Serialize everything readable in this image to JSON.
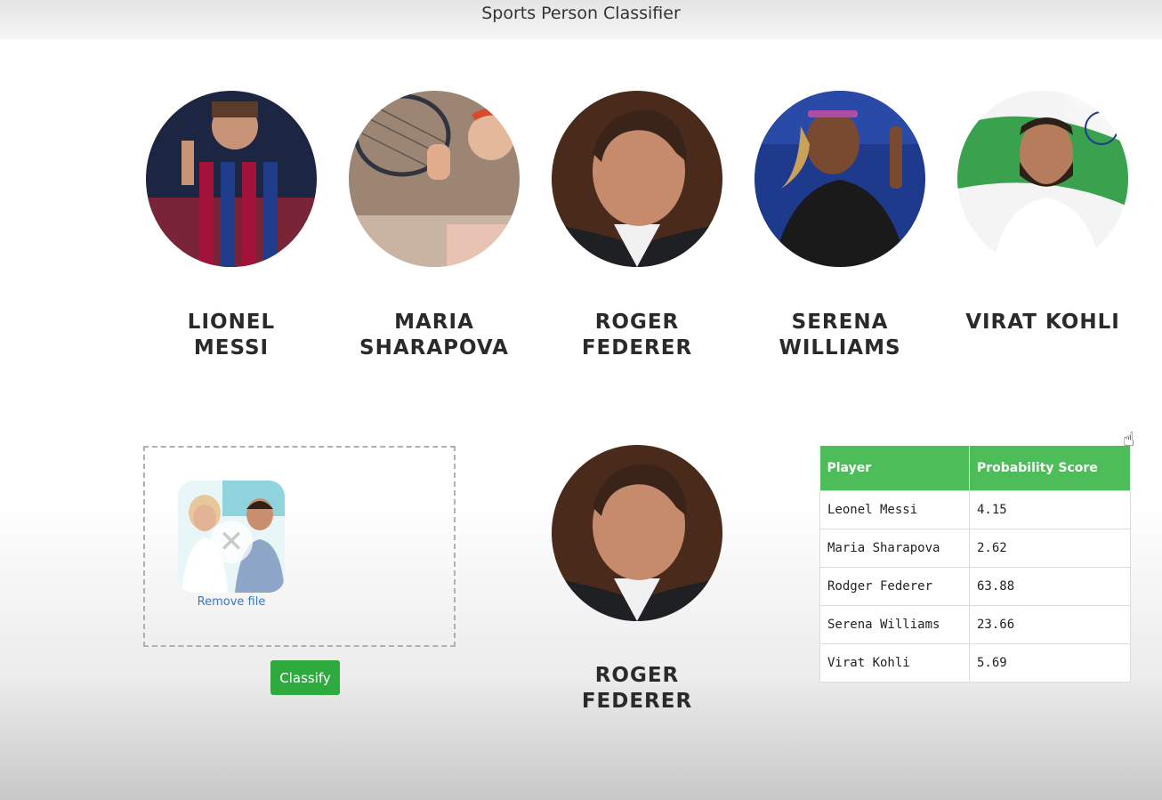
{
  "header": {
    "title": "Sports Person Classifier"
  },
  "players": [
    {
      "id": "messi",
      "name_line1": "LIONEL",
      "name_line2": "MESSI"
    },
    {
      "id": "sharapova",
      "name_line1": "MARIA",
      "name_line2": "SHARAPOVA"
    },
    {
      "id": "federer",
      "name_line1": "ROGER",
      "name_line2": "FEDERER"
    },
    {
      "id": "williams",
      "name_line1": "SERENA",
      "name_line2": "WILLIAMS"
    },
    {
      "id": "kohli",
      "name_line1": "VIRAT KOHLI",
      "name_line2": ""
    }
  ],
  "upload": {
    "remove_label": "Remove file",
    "classify_label": "Classify"
  },
  "result": {
    "name": "ROGER FEDERER"
  },
  "table": {
    "headers": [
      "Player",
      "Probability Score"
    ],
    "rows": [
      {
        "player": "Leonel Messi",
        "score": "4.15"
      },
      {
        "player": "Maria Sharapova",
        "score": "2.62"
      },
      {
        "player": "Rodger Federer",
        "score": "63.88"
      },
      {
        "player": "Serena Williams",
        "score": "23.66"
      },
      {
        "player": "Virat Kohli",
        "score": "5.69"
      }
    ]
  },
  "colors": {
    "accent_green": "#4cbd58",
    "button_green": "#2faa3e",
    "link_blue": "#3a78c9"
  },
  "icons": {
    "cursor": "hand-pointer-icon",
    "remove": "close-icon"
  }
}
